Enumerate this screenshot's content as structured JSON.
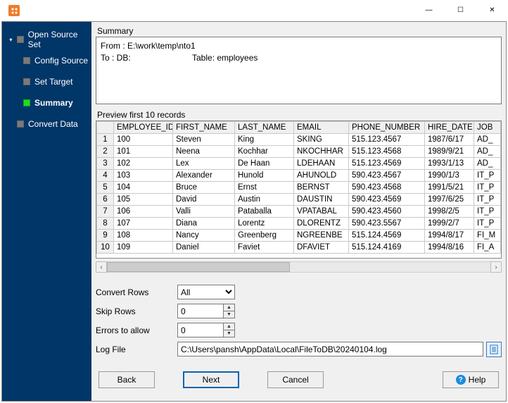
{
  "titlebar": {
    "minimize_glyph": "—",
    "maximize_glyph": "☐",
    "close_glyph": "✕"
  },
  "sidebar": {
    "items": [
      {
        "label": "Open Source Set",
        "level": 0,
        "active": false,
        "expander": "▾"
      },
      {
        "label": "Config Source",
        "level": 1,
        "active": false,
        "expander": ""
      },
      {
        "label": "Set Target",
        "level": 1,
        "active": false,
        "expander": ""
      },
      {
        "label": "Summary",
        "level": 1,
        "active": true,
        "expander": ""
      },
      {
        "label": "Convert Data",
        "level": 0,
        "active": false,
        "expander": ""
      }
    ]
  },
  "summary": {
    "heading": "Summary",
    "line1": "From : E:\\work\\temp\\nto1",
    "line2_left": "To : DB:",
    "line2_right": "Table: employees"
  },
  "preview": {
    "heading": "Preview first 10 records",
    "columns": [
      "EMPLOYEE_ID",
      "FIRST_NAME",
      "LAST_NAME",
      "EMAIL",
      "PHONE_NUMBER",
      "HIRE_DATE",
      "JOB"
    ],
    "rows": [
      [
        "100",
        "Steven",
        "King",
        "SKING",
        "515.123.4567",
        "1987/6/17",
        "AD_"
      ],
      [
        "101",
        "Neena",
        "Kochhar",
        "NKOCHHAR",
        "515.123.4568",
        "1989/9/21",
        "AD_"
      ],
      [
        "102",
        "Lex",
        "De Haan",
        "LDEHAAN",
        "515.123.4569",
        "1993/1/13",
        "AD_"
      ],
      [
        "103",
        "Alexander",
        "Hunold",
        "AHUNOLD",
        "590.423.4567",
        "1990/1/3",
        "IT_P"
      ],
      [
        "104",
        "Bruce",
        "Ernst",
        "BERNST",
        "590.423.4568",
        "1991/5/21",
        "IT_P"
      ],
      [
        "105",
        "David",
        "Austin",
        "DAUSTIN",
        "590.423.4569",
        "1997/6/25",
        "IT_P"
      ],
      [
        "106",
        "Valli",
        "Pataballa",
        "VPATABAL",
        "590.423.4560",
        "1998/2/5",
        "IT_P"
      ],
      [
        "107",
        "Diana",
        "Lorentz",
        "DLORENTZ",
        "590.423.5567",
        "1999/2/7",
        "IT_P"
      ],
      [
        "108",
        "Nancy",
        "Greenberg",
        "NGREENBE",
        "515.124.4569",
        "1994/8/17",
        "FI_M"
      ],
      [
        "109",
        "Daniel",
        "Faviet",
        "DFAVIET",
        "515.124.4169",
        "1994/8/16",
        "FI_A"
      ]
    ]
  },
  "form": {
    "convert_rows_label": "Convert Rows",
    "convert_rows_value": "All",
    "skip_rows_label": "Skip Rows",
    "skip_rows_value": "0",
    "errors_label": "Errors to allow",
    "errors_value": "0",
    "log_file_label": "Log File",
    "log_file_value": "C:\\Users\\pansh\\AppData\\Local\\FileToDB\\20240104.log"
  },
  "buttons": {
    "back": "Back",
    "next": "Next",
    "cancel": "Cancel",
    "help": "Help"
  }
}
